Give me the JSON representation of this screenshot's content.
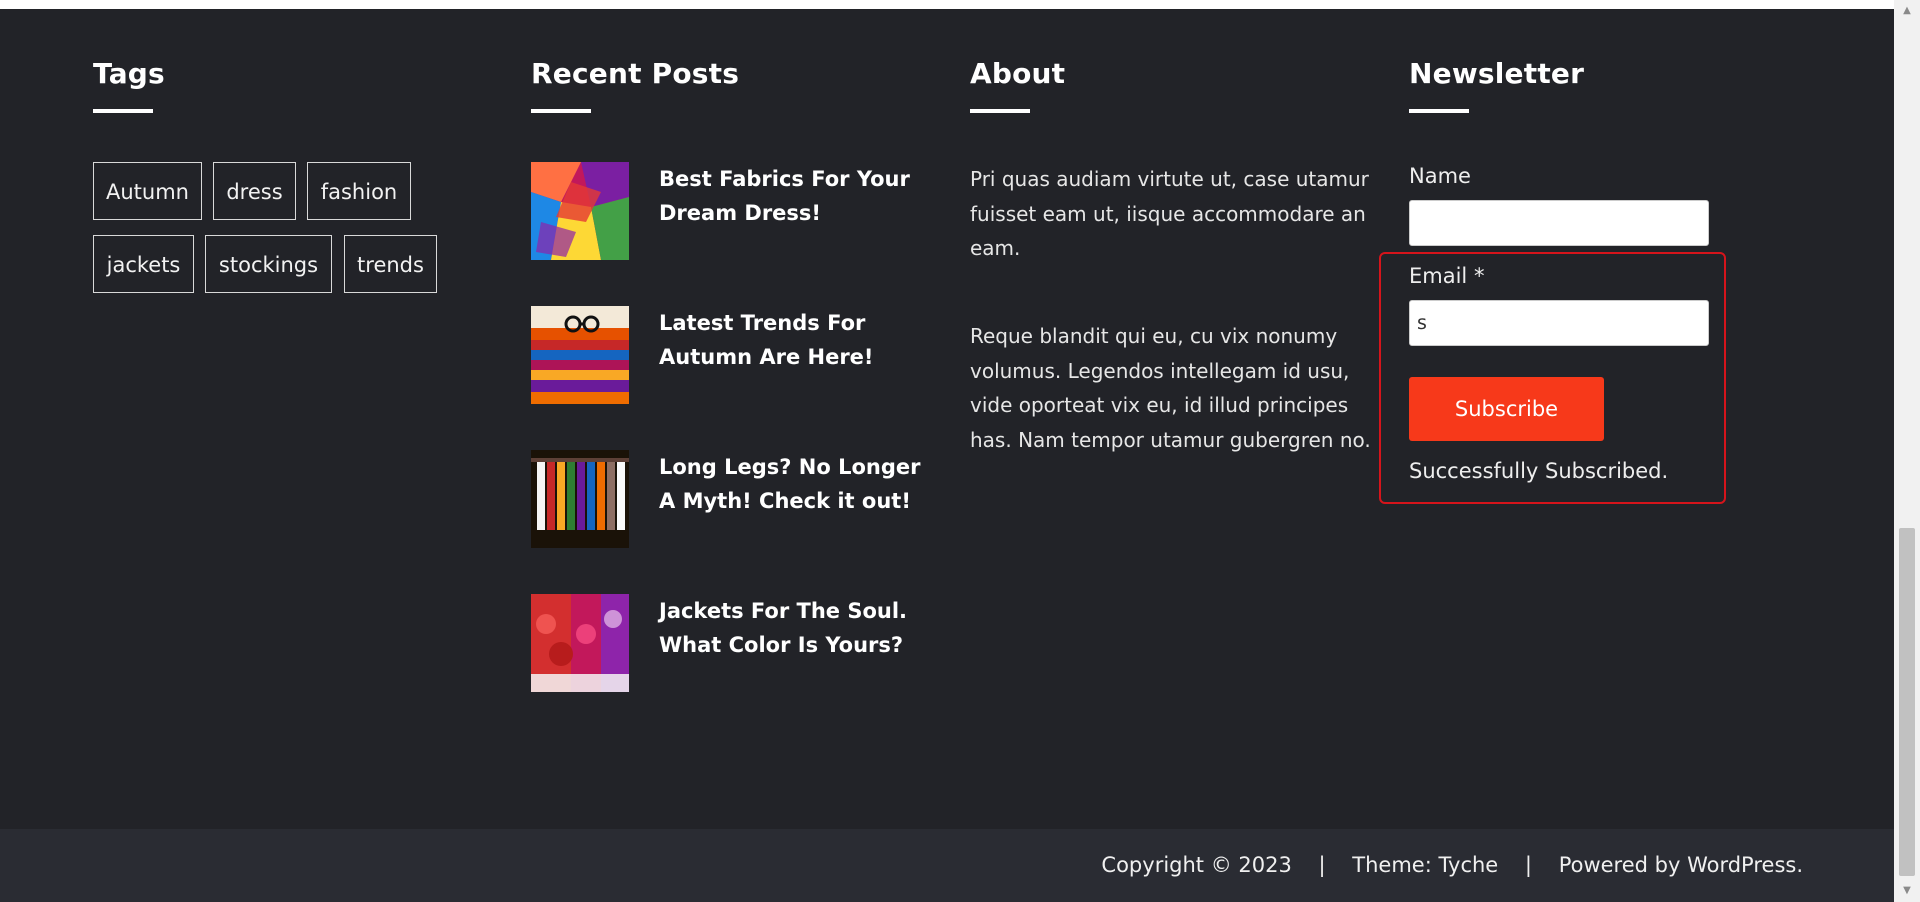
{
  "tags": {
    "title": "Tags",
    "items": [
      "Autumn",
      "dress",
      "fashion",
      "jackets",
      "stockings",
      "trends"
    ]
  },
  "recent_posts": {
    "title": "Recent Posts",
    "items": [
      {
        "title": "Best Fabrics For Your Dream Dress!"
      },
      {
        "title": "Latest Trends For Autumn Are Here!"
      },
      {
        "title": "Long Legs? No Longer A Myth! Check it out!"
      },
      {
        "title": "Jackets For The Soul. What Color Is Yours?"
      }
    ]
  },
  "about": {
    "title": "About",
    "p1": "Pri quas audiam virtute ut, case utamur fuisset eam ut, iisque accommodare an eam.",
    "p2": "Reque blandit qui eu, cu vix nonumy volumus. Legendos intellegam id usu, vide oporteat vix eu, id illud principes has. Nam tempor utamur gubergren no."
  },
  "newsletter": {
    "title": "Newsletter",
    "name_label": "Name",
    "name_value": "",
    "email_label": "Email *",
    "email_value": "s",
    "subscribe_label": "Subscribe",
    "success_message": "Successfully Subscribed."
  },
  "bottom_bar": {
    "copyright": "Copyright © 2023",
    "sep": "|",
    "theme": "Theme: Tyche",
    "powered": "Powered by WordPress."
  },
  "colors": {
    "footer_bg": "#222328",
    "bottom_bar_bg": "#2a2c33",
    "accent": "#f7391a",
    "highlight": "#d6141b"
  }
}
